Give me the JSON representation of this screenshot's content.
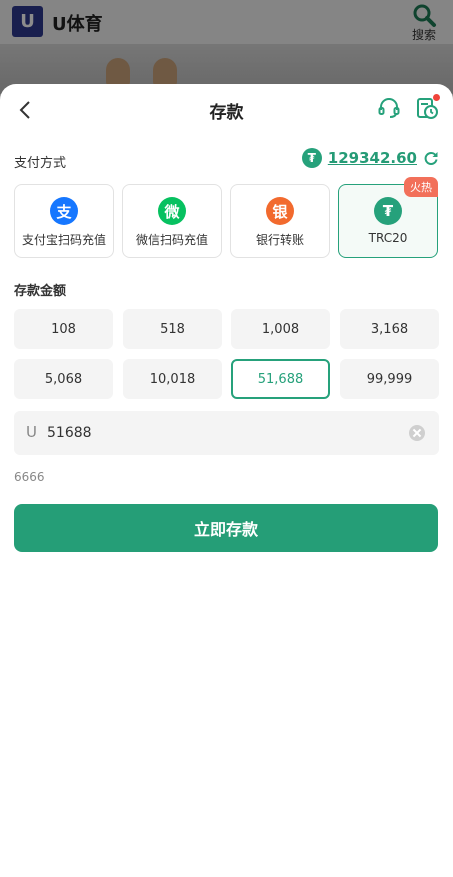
{
  "background": {
    "logo_letter": "U",
    "app_name": "U体育",
    "search_label": "搜索"
  },
  "header": {
    "title": "存款"
  },
  "payment": {
    "label": "支付方式",
    "balance": "129342.60",
    "coin_symbol": "₮",
    "methods": [
      {
        "icon_char": "支",
        "label": "支付宝扫码充值",
        "color": "#1677ff"
      },
      {
        "icon_char": "微",
        "label": "微信扫码充值",
        "color": "#07c160"
      },
      {
        "icon_char": "银",
        "label": "银行转账",
        "color": "#f26a2e"
      },
      {
        "icon_char": "₮",
        "label": "TRC20",
        "color": "#26a17b",
        "badge": "火热"
      }
    ],
    "selected_method": "TRC20"
  },
  "amount": {
    "label": "存款金额",
    "options": [
      "108",
      "518",
      "1,008",
      "3,168",
      "5,068",
      "10,018",
      "51,688",
      "99,999"
    ],
    "selected": "51,688",
    "input_prefix": "U",
    "input_value": "51688",
    "hint": "6666"
  },
  "submit_label": "立即存款",
  "colors": {
    "accent": "#26a17b",
    "hot_badge": "#f2705a",
    "notification_dot": "#f0443a"
  }
}
